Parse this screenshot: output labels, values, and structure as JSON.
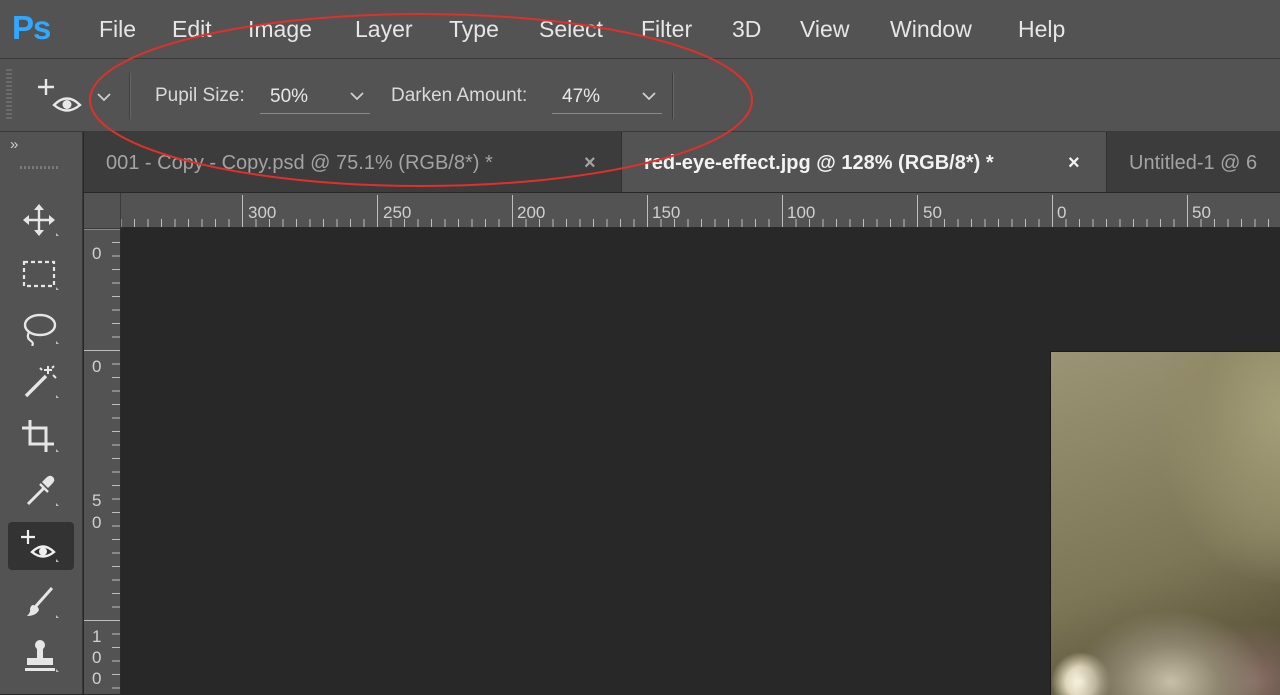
{
  "app": {
    "logo": "Ps",
    "brand_color": "#31a8ff"
  },
  "menu": [
    "File",
    "Edit",
    "Image",
    "Layer",
    "Type",
    "Select",
    "Filter",
    "3D",
    "View",
    "Window",
    "Help"
  ],
  "options": {
    "tool_icon": "red-eye-tool-icon",
    "pupil_size_label": "Pupil Size:",
    "pupil_size_value": "50%",
    "darken_amount_label": "Darken Amount:",
    "darken_amount_value": "47%"
  },
  "tabs": [
    {
      "title": "001 - Copy - Copy.psd @ 75.1% (RGB/8*) *",
      "close": "×",
      "active": false
    },
    {
      "title": "red-eye-effect.jpg @ 128% (RGB/8*) *",
      "close": "×",
      "active": true
    },
    {
      "title": "Untitled-1 @ 6",
      "close": "",
      "active": false
    }
  ],
  "toolbar": {
    "collapse": "»",
    "tools": [
      "move-tool",
      "rectangular-marquee-tool",
      "lasso-tool",
      "magic-wand-tool",
      "crop-tool",
      "eyedropper-tool",
      "red-eye-tool",
      "brush-tool",
      "clone-stamp-tool"
    ],
    "active_tool": "red-eye-tool"
  },
  "ruler_h": {
    "labels": [
      "300",
      "250",
      "200",
      "150",
      "100",
      "50",
      "0",
      "50"
    ]
  },
  "ruler_v": {
    "labels": [
      "0",
      "0",
      "5",
      "0",
      "1",
      "0",
      "0"
    ]
  },
  "annotation_color": "#e0302a"
}
